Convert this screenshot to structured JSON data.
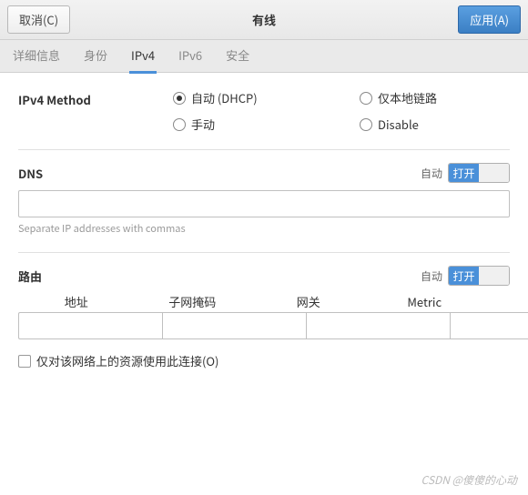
{
  "header": {
    "cancel": "取消(C)",
    "title": "有线",
    "apply": "应用(A)"
  },
  "tabs": {
    "details": "详细信息",
    "identity": "身份",
    "ipv4": "IPv4",
    "ipv6": "IPv6",
    "security": "安全"
  },
  "method": {
    "label": "IPv4 Method",
    "opts": {
      "dhcp": "自动 (DHCP)",
      "linklocal": "仅本地链路",
      "manual": "手动",
      "disable": "Disable"
    }
  },
  "dns": {
    "label": "DNS",
    "auto": "自动",
    "on": "打开",
    "hint": "Separate IP addresses with commas",
    "value": ""
  },
  "routes": {
    "label": "路由",
    "auto": "自动",
    "on": "打开",
    "cols": {
      "addr": "地址",
      "mask": "子网掩码",
      "gw": "网关",
      "metric": "Metric"
    },
    "row": {
      "addr": "",
      "mask": "",
      "gw": "",
      "metric": ""
    }
  },
  "onlyResources": "仅对该网络上的资源使用此连接(O)",
  "watermark": "CSDN @傻傻的心动"
}
